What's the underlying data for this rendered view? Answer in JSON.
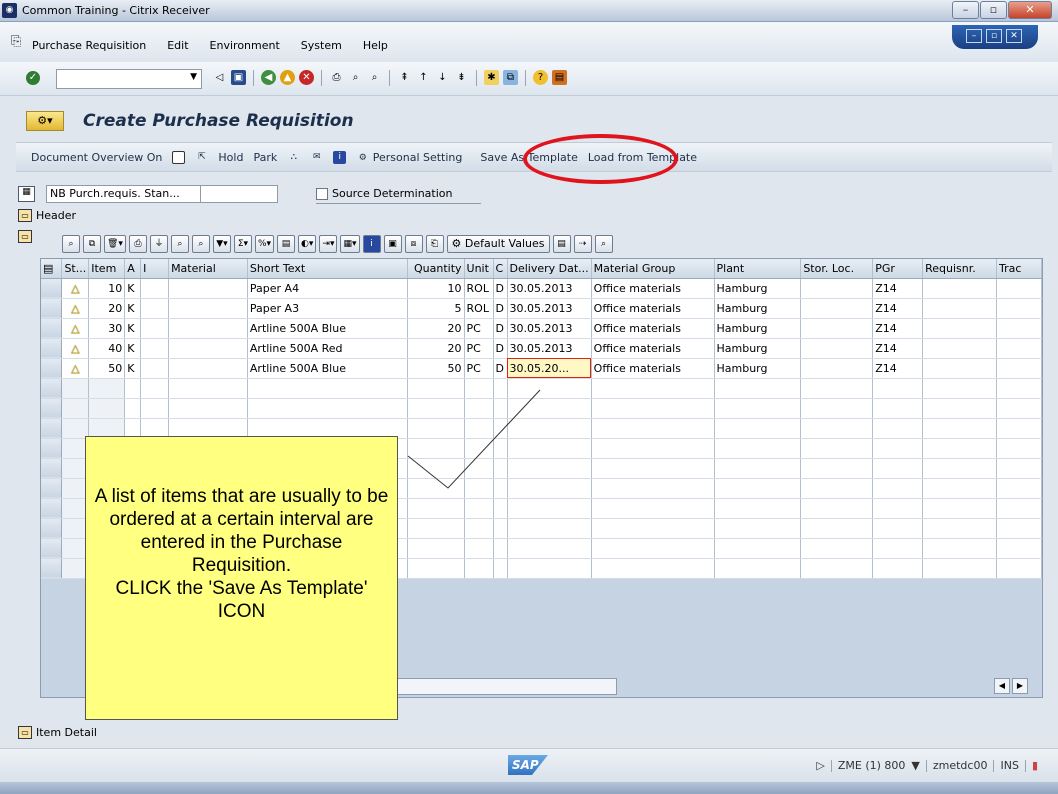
{
  "window": {
    "title": "Common Training - Citrix Receiver"
  },
  "menu": {
    "items": [
      "Purchase Requisition",
      "Edit",
      "Environment",
      "System",
      "Help"
    ]
  },
  "page_title": "Create Purchase Requisition",
  "app_toolbar": {
    "doc_overview": "Document Overview On",
    "hold": "Hold",
    "park": "Park",
    "personal_setting": "Personal Setting",
    "save_as_template": "Save As Template",
    "load_from_template": "Load from Template"
  },
  "doc": {
    "type": "NB Purch.requis. Stan...",
    "source_determination": "Source Determination"
  },
  "header_label": "Header",
  "item_detail_label": "Item Detail",
  "grid_toolbar": {
    "default_values": "Default Values"
  },
  "table": {
    "columns": [
      "St...",
      "Item",
      "A",
      "I",
      "Material",
      "Short Text",
      "Quantity",
      "Unit",
      "C",
      "Delivery Dat...",
      "Material Group",
      "Plant",
      "Stor. Loc.",
      "PGr",
      "Requisnr.",
      "Trac"
    ],
    "rows": [
      {
        "item": "10",
        "a": "K",
        "text": "Paper A4",
        "qty": "10",
        "unit": "ROL",
        "c": "D",
        "date": "30.05.2013",
        "group": "Office materials",
        "plant": "Hamburg",
        "pgr": "Z14"
      },
      {
        "item": "20",
        "a": "K",
        "text": "Paper A3",
        "qty": "5",
        "unit": "ROL",
        "c": "D",
        "date": "30.05.2013",
        "group": "Office materials",
        "plant": "Hamburg",
        "pgr": "Z14"
      },
      {
        "item": "30",
        "a": "K",
        "text": "Artline 500A Blue",
        "qty": "20",
        "unit": "PC",
        "c": "D",
        "date": "30.05.2013",
        "group": "Office materials",
        "plant": "Hamburg",
        "pgr": "Z14"
      },
      {
        "item": "40",
        "a": "K",
        "text": "Artline 500A Red",
        "qty": "20",
        "unit": "PC",
        "c": "D",
        "date": "30.05.2013",
        "group": "Office materials",
        "plant": "Hamburg",
        "pgr": "Z14"
      },
      {
        "item": "50",
        "a": "K",
        "text": "Artline 500A Blue",
        "qty": "50",
        "unit": "PC",
        "c": "D",
        "date": "30.05.20...",
        "group": "Office materials",
        "plant": "Hamburg",
        "pgr": "Z14"
      }
    ]
  },
  "callout": {
    "line1": "A list of items that are usually to be ordered at a certain interval are entered in the Purchase Requisition.",
    "line2": "CLICK the 'Save As Template' ICON"
  },
  "statusbar": {
    "session": "ZME (1) 800",
    "server": "zmetdc00",
    "mode": "INS",
    "logo": "SAP"
  },
  "colors": {
    "highlight": "#e0141c",
    "callout": "#ffff80"
  }
}
